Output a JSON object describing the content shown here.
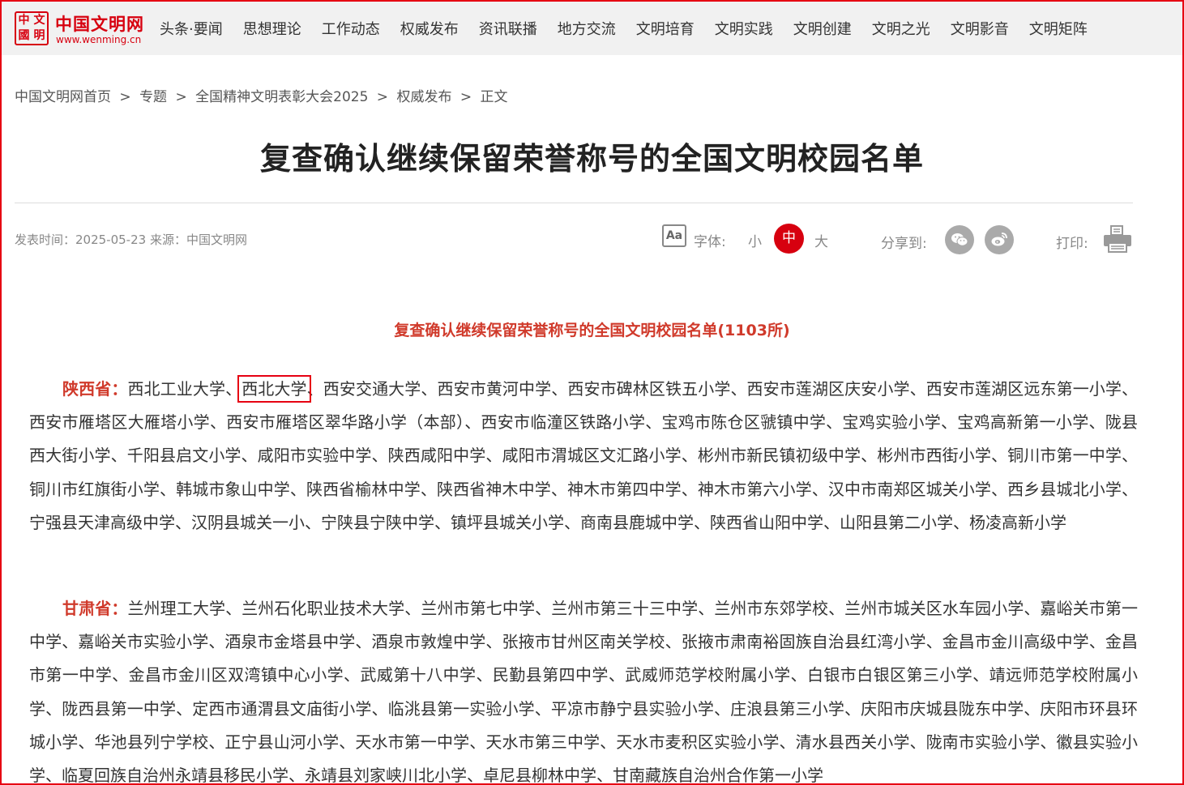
{
  "logo": {
    "seal": [
      "中",
      "文",
      "國",
      "明"
    ],
    "title": "中国文明网",
    "url": "www.wenming.cn"
  },
  "nav": [
    "头条·要闻",
    "思想理论",
    "工作动态",
    "权威发布",
    "资讯联播",
    "地方交流",
    "文明培育",
    "文明实践",
    "文明创建",
    "文明之光",
    "文明影音",
    "文明矩阵"
  ],
  "breadcrumb": [
    "中国文明网首页",
    "专题",
    "全国精神文明表彰大会2025",
    "权威发布",
    "正文"
  ],
  "breadcrumb_sep": ">",
  "article": {
    "headline": "复查确认继续保留荣誉称号的全国文明校园名单",
    "meta": "发表时间：2025-05-23 来源：中国文明网",
    "subtitle": "复查确认继续保留荣誉称号的全国文明校园名单(1103所)"
  },
  "tools": {
    "font_label": "字体:",
    "font_small": "小",
    "font_mid": "中",
    "font_large": "大",
    "share_label": "分享到:",
    "print_label": "打印:"
  },
  "sections": [
    {
      "province": "陕西省：",
      "first": "西北工业大学",
      "highlight": "西北大学",
      "rest": "、西安交通大学、西安市黄河中学、西安市碑林区铁五小学、西安市莲湖区庆安小学、西安市莲湖区远东第一小学、西安市雁塔区大雁塔小学、西安市雁塔区翠华路小学（本部）、西安市临潼区铁路小学、宝鸡市陈仓区虢镇中学、宝鸡实验小学、宝鸡高新第一小学、陇县西大街小学、千阳县启文小学、咸阳市实验中学、陕西咸阳中学、咸阳市渭城区文汇路小学、彬州市新民镇初级中学、彬州市西街小学、铜川市第一中学、铜川市红旗街小学、韩城市象山中学、陕西省榆林中学、陕西省神木中学、神木市第四中学、神木市第六小学、汉中市南郑区城关小学、西乡县城北小学、宁强县天津高级中学、汉阴县城关一小、宁陕县宁陕中学、镇坪县城关小学、商南县鹿城中学、陕西省山阳中学、山阳县第二小学、杨凌高新小学"
    },
    {
      "province": "甘肃省：",
      "text": "兰州理工大学、兰州石化职业技术大学、兰州市第七中学、兰州市第三十三中学、兰州市东郊学校、兰州市城关区水车园小学、嘉峪关市第一中学、嘉峪关市实验小学、酒泉市金塔县中学、酒泉市敦煌中学、张掖市甘州区南关学校、张掖市肃南裕固族自治县红湾小学、金昌市金川高级中学、金昌市第一中学、金昌市金川区双湾镇中心小学、武威第十八中学、民勤县第四中学、武威师范学校附属小学、白银市白银区第三小学、靖远师范学校附属小学、陇西县第一中学、定西市通渭县文庙街小学、临洮县第一实验小学、平凉市静宁县实验小学、庄浪县第三小学、庆阳市庆城县陇东中学、庆阳市环县环城小学、华池县列宁学校、正宁县山河小学、天水市第一中学、天水市第三中学、天水市麦积区实验小学、清水县西关小学、陇南市实验小学、徽县实验小学、临夏回族自治州永靖县移民小学、永靖县刘家峡川北小学、卓尼县柳林中学、甘南藏族自治州合作第一小学"
    }
  ],
  "colors": {
    "brand_red": "#d7000f",
    "province_red": "#d03a2b",
    "topbar_bg": "#f1f1f1"
  }
}
